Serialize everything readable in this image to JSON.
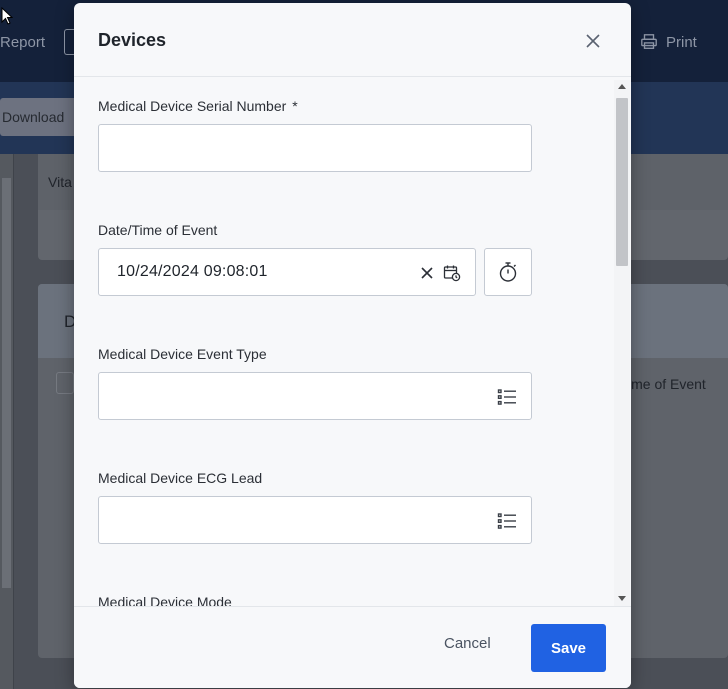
{
  "background": {
    "report_label": "Report",
    "print_label": "Print",
    "download_label": "Download",
    "card1_tab": "Vita",
    "card2_title": "D",
    "card2_column": "ime of Event"
  },
  "modal": {
    "title": "Devices",
    "fields": {
      "serial": {
        "label": "Medical Device Serial Number",
        "required_marker": "*",
        "value": ""
      },
      "datetime": {
        "label": "Date/Time of Event",
        "value": "10/24/2024 09:08:01"
      },
      "event_type": {
        "label": "Medical Device Event Type",
        "value": ""
      },
      "ecg_lead": {
        "label": "Medical Device ECG Lead",
        "value": ""
      },
      "mode": {
        "label": "Medical Device Mode"
      }
    },
    "footer": {
      "cancel_label": "Cancel",
      "save_label": "Save"
    }
  },
  "colors": {
    "primary": "#2062e3",
    "modal_bg": "#f7f8fa",
    "backdrop": "#5a5e66"
  }
}
